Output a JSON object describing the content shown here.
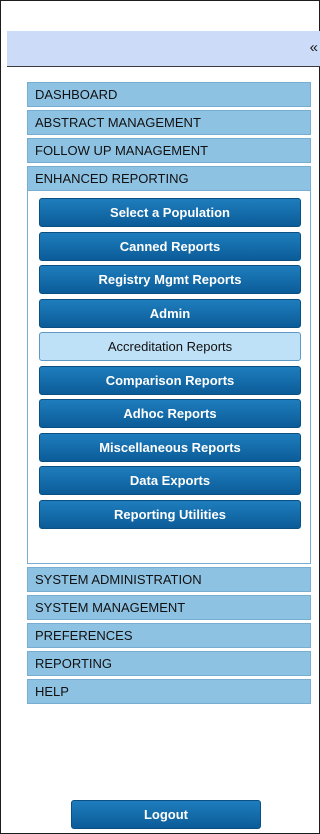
{
  "topbar": {
    "collapse_icon": "«"
  },
  "nav": {
    "dashboard": "DASHBOARD",
    "abstract": "ABSTRACT MANAGEMENT",
    "followup": "FOLLOW UP MANAGEMENT",
    "enhanced": "ENHANCED REPORTING",
    "sysadmin": "SYSTEM ADMINISTRATION",
    "sysmgmt": "SYSTEM MANAGEMENT",
    "preferences": "PREFERENCES",
    "reporting": "REPORTING",
    "help": "HELP"
  },
  "submenu": {
    "items": [
      "Select a Population",
      "Canned Reports",
      "Registry Mgmt Reports",
      "Admin",
      "Accreditation Reports",
      "Comparison Reports",
      "Adhoc Reports",
      "Miscellaneous Reports",
      "Data Exports",
      "Reporting Utilities"
    ],
    "active_item": "Accreditation Reports"
  },
  "logout_label": "Logout",
  "colors": {
    "topbar": "#ccdcf8",
    "nav_item": "#8ec2e3",
    "button": "#0f6aa8",
    "active_button": "#bfe1f7"
  }
}
